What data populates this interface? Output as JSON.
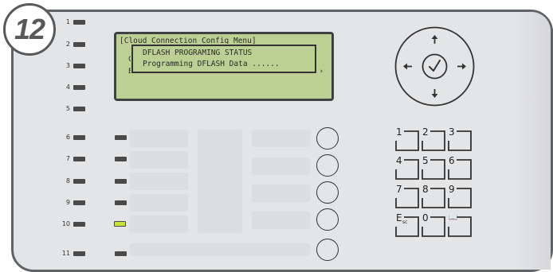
{
  "step": {
    "number": "12"
  },
  "leds": [
    {
      "label": "1"
    },
    {
      "label": "2"
    },
    {
      "label": "3"
    },
    {
      "label": "4"
    },
    {
      "label": "5"
    },
    {
      "label": "6"
    },
    {
      "label": "7"
    },
    {
      "label": "8"
    },
    {
      "label": "9"
    },
    {
      "label": "10"
    },
    {
      "label": "11"
    }
  ],
  "lcd": {
    "menu_title": "[Cloud Connection Config Menu]",
    "bg_char_1": "C",
    "bg_char_2": "E",
    "bg_char_3": "›",
    "dialog_line1": "DFLASH PROGRAMING STATUS",
    "dialog_line2": "Programming DFLASH Data ......"
  },
  "keypad": {
    "keys": [
      {
        "label": "1"
      },
      {
        "label": "2"
      },
      {
        "label": "3"
      },
      {
        "label": "4"
      },
      {
        "label": "5"
      },
      {
        "label": "6"
      },
      {
        "label": "7"
      },
      {
        "label": "8"
      },
      {
        "label": "9"
      },
      {
        "label": "E"
      },
      {
        "label": "0"
      },
      {
        "label": "📖"
      }
    ],
    "esc_sub": "sc"
  },
  "colors": {
    "lcd_bg": "#bcd094",
    "panel": "#e4e5e7",
    "led_active": "#c8e23a"
  },
  "icons": {
    "nav": [
      "arrow-up-icon",
      "arrow-left-icon",
      "arrow-right-icon",
      "arrow-down-icon",
      "check-enter-icon"
    ],
    "active_led": "green-led"
  }
}
